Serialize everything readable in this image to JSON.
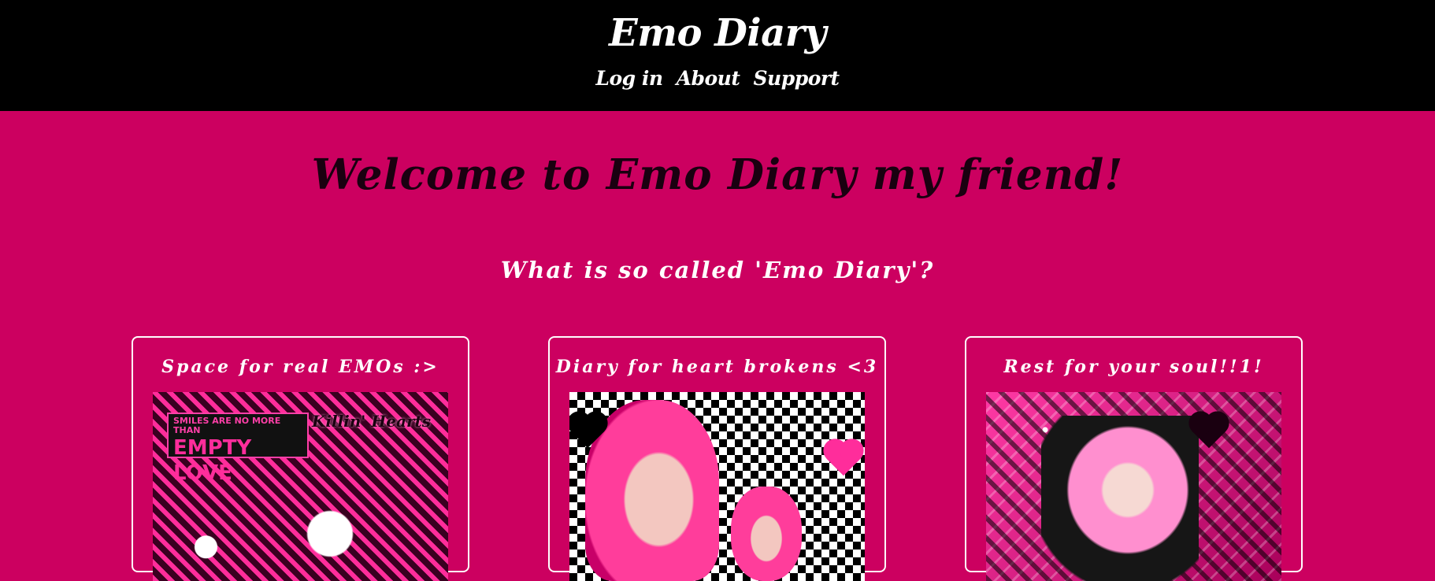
{
  "header": {
    "title": "Emo Diary",
    "nav": [
      {
        "label": "Log in"
      },
      {
        "label": "About"
      },
      {
        "label": "Support"
      }
    ]
  },
  "main": {
    "welcome": "Welcome to Emo Diary my friend!",
    "subheading": "What is so called 'Emo Diary'?",
    "cards": [
      {
        "title": "Space for real EMOs :>",
        "image_text": {
          "small": "SMILES ARE NO MORE THAN",
          "big": "EMPTY LOVE",
          "scribble": "Killin' Hearts"
        }
      },
      {
        "title": "Diary for heart brokens <3"
      },
      {
        "title": "Rest for your soul!!1!"
      }
    ]
  },
  "colors": {
    "header_bg": "#000000",
    "page_bg": "#cc0060",
    "accent_pink": "#ff2d9b",
    "text_dark": "#1a0010",
    "text_light": "#ffffff"
  }
}
